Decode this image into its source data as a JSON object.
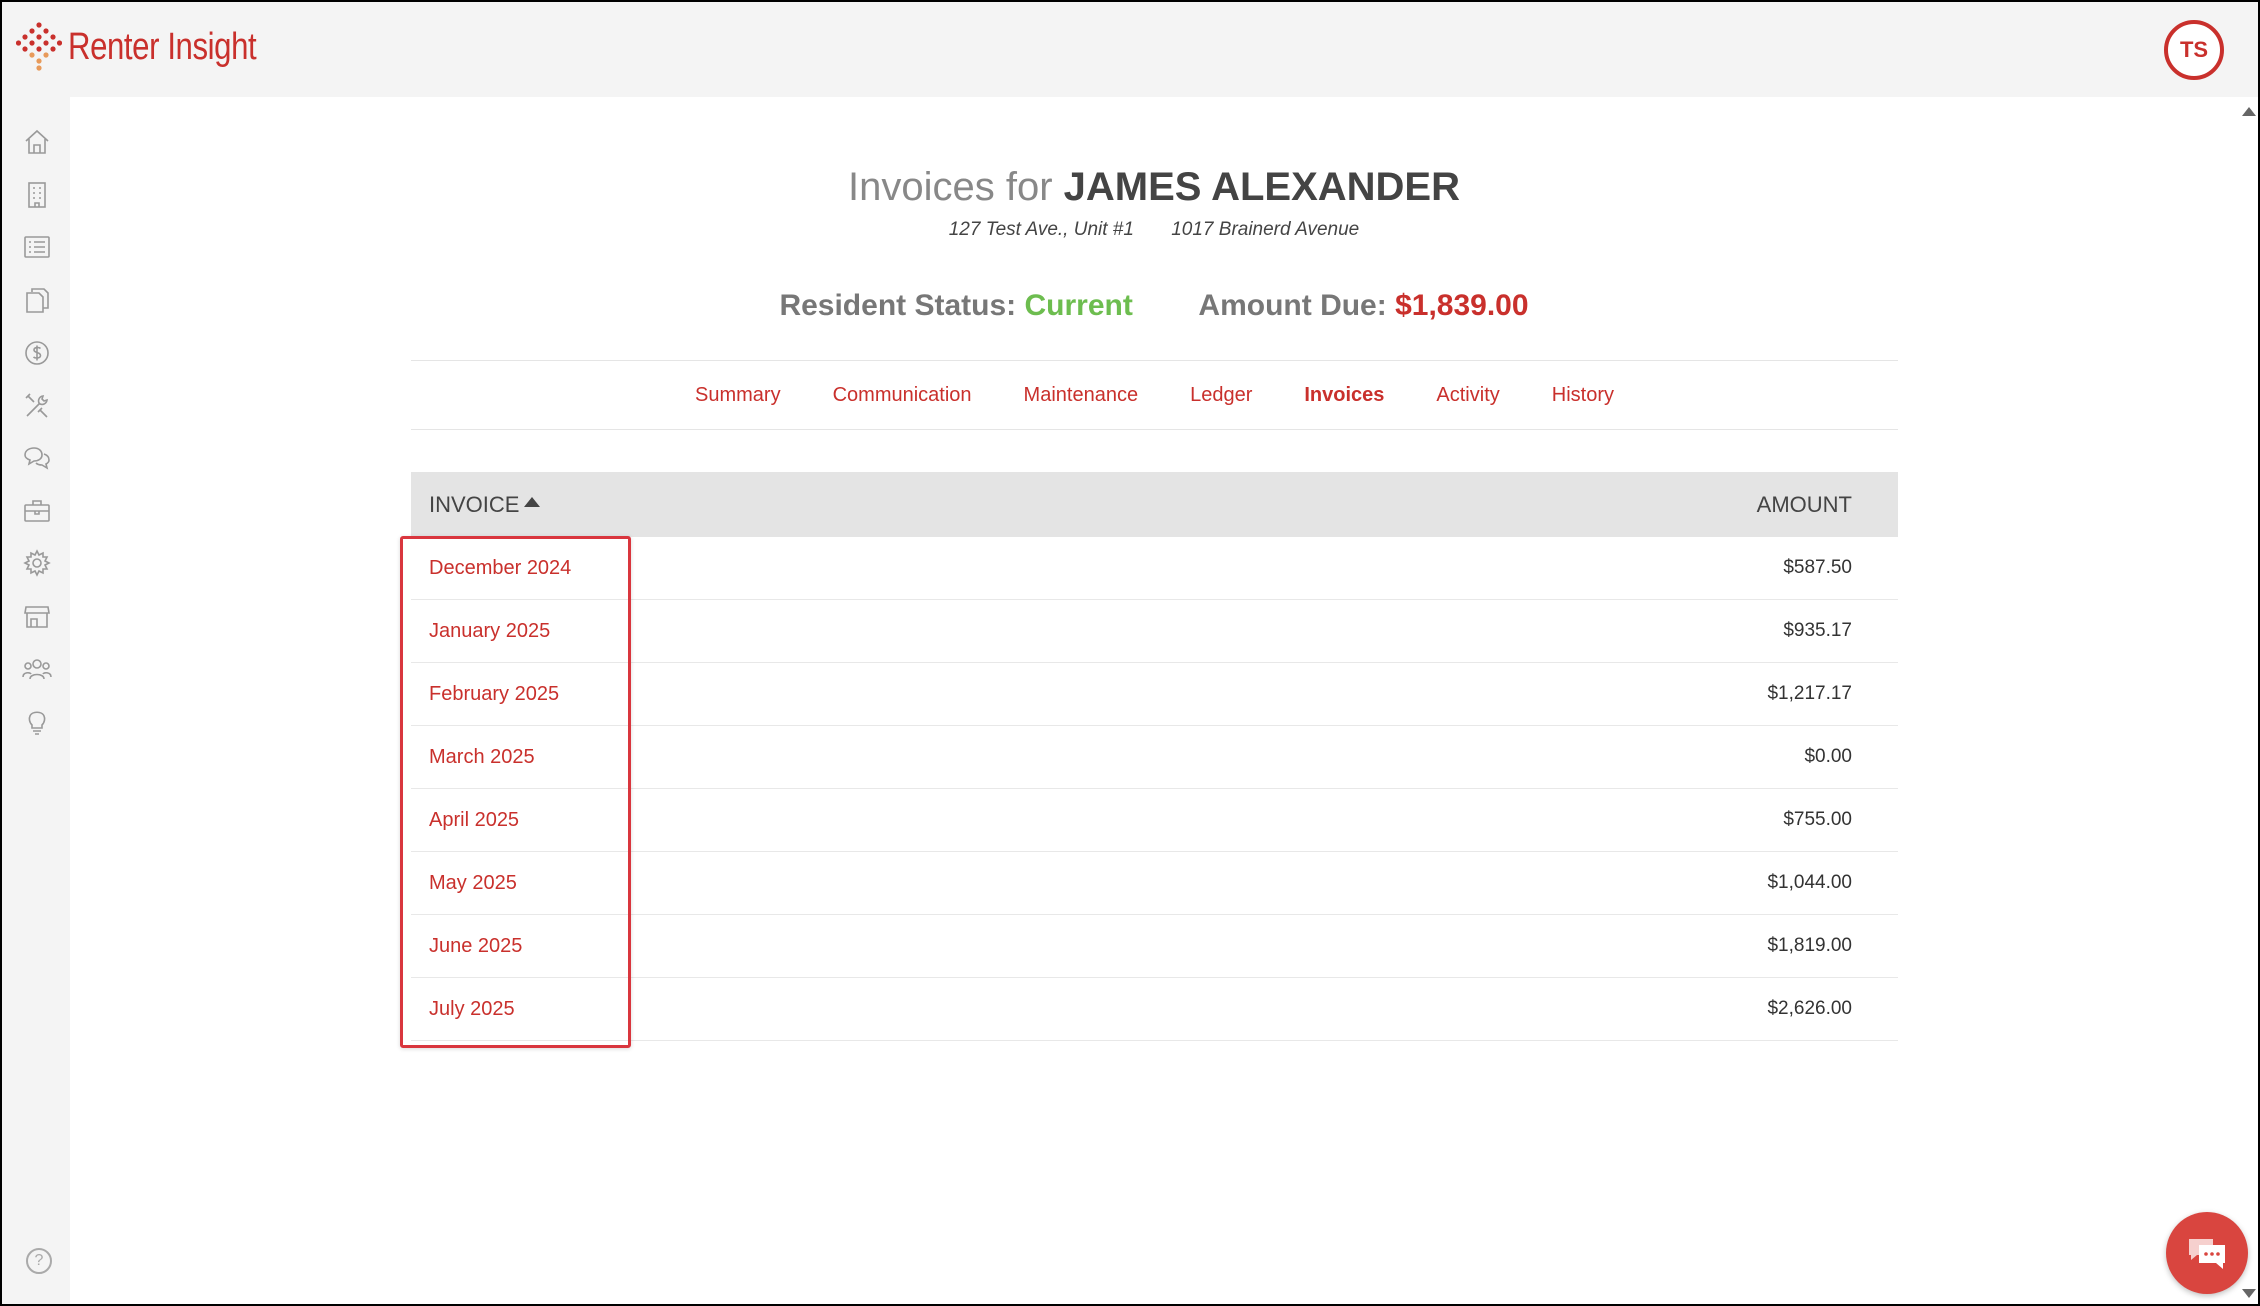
{
  "app": {
    "name": "Renter Insight",
    "user_initials": "TS"
  },
  "header": {
    "title_prefix": "Invoices for",
    "resident_name": "JAMES ALEXANDER",
    "address_1": "127 Test Ave., Unit #1",
    "address_2": "1017 Brainerd Avenue",
    "status_label": "Resident Status:",
    "status_value": "Current",
    "due_label": "Amount Due:",
    "due_value": "$1,839.00"
  },
  "tabs": [
    {
      "label": "Summary",
      "active": false
    },
    {
      "label": "Communication",
      "active": false
    },
    {
      "label": "Maintenance",
      "active": false
    },
    {
      "label": "Ledger",
      "active": false
    },
    {
      "label": "Invoices",
      "active": true
    },
    {
      "label": "Activity",
      "active": false
    },
    {
      "label": "History",
      "active": false
    }
  ],
  "table": {
    "columns": {
      "invoice": "INVOICE",
      "amount": "AMOUNT"
    },
    "rows": [
      {
        "invoice": "December 2024",
        "amount": "$587.50"
      },
      {
        "invoice": "January 2025",
        "amount": "$935.17"
      },
      {
        "invoice": "February 2025",
        "amount": "$1,217.17"
      },
      {
        "invoice": "March 2025",
        "amount": "$0.00"
      },
      {
        "invoice": "April 2025",
        "amount": "$755.00"
      },
      {
        "invoice": "May 2025",
        "amount": "$1,044.00"
      },
      {
        "invoice": "June 2025",
        "amount": "$1,819.00"
      },
      {
        "invoice": "July 2025",
        "amount": "$2,626.00"
      }
    ]
  },
  "sidebar": {
    "icons": [
      "home-icon",
      "building-icon",
      "list-icon",
      "documents-icon",
      "dollar-icon",
      "tools-icon",
      "chat-icon",
      "briefcase-icon",
      "gear-icon",
      "store-icon",
      "people-icon",
      "lightbulb-icon"
    ],
    "help": "?"
  },
  "colors": {
    "brand": "#c9302c",
    "status_current": "#6dbd4f",
    "highlight": "#d9363e"
  }
}
